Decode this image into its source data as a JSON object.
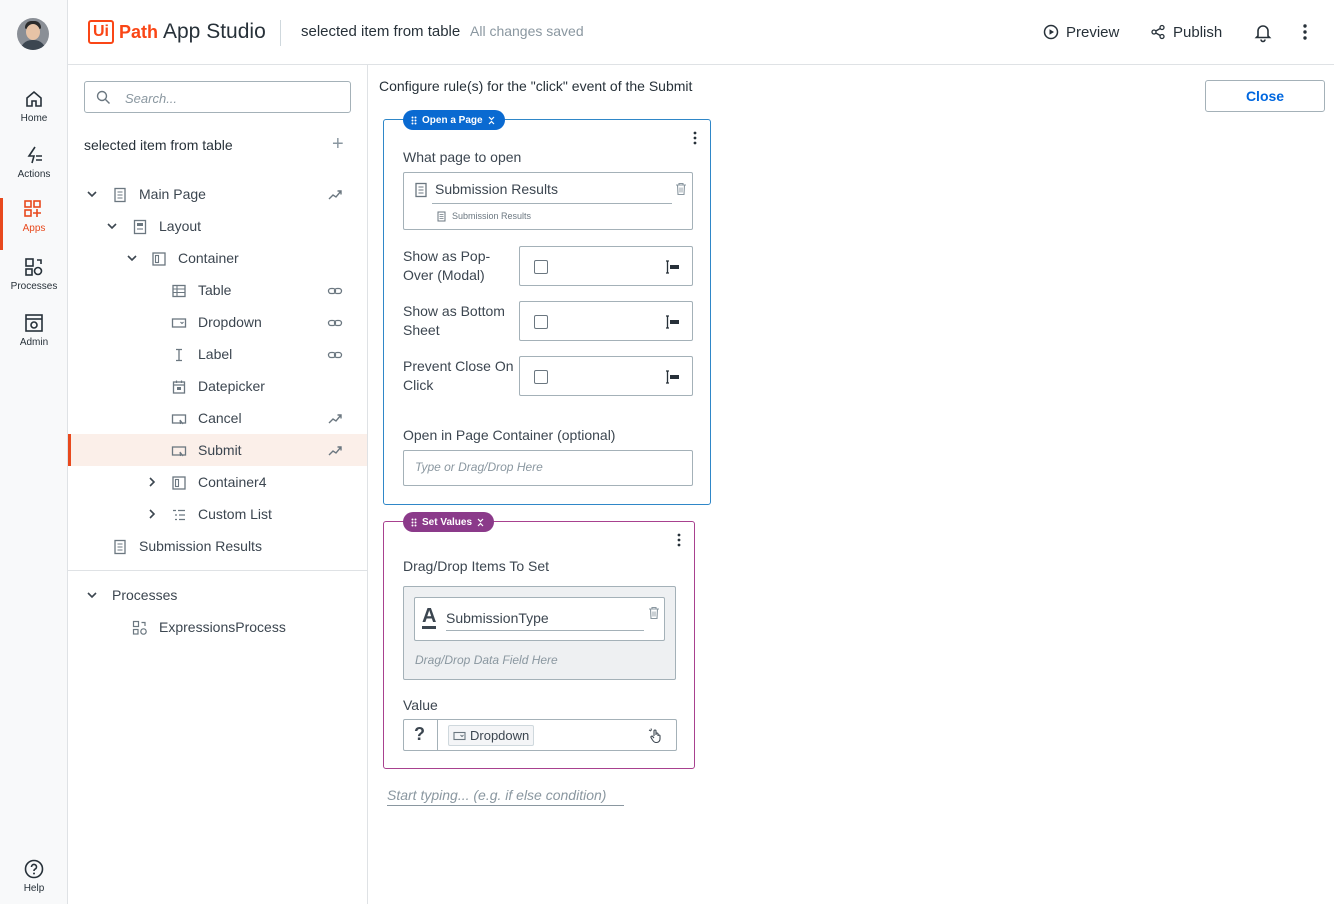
{
  "nav": {
    "items": [
      {
        "label": "Home",
        "icon": "home-icon"
      },
      {
        "label": "Actions",
        "icon": "actions-icon"
      },
      {
        "label": "Apps",
        "icon": "apps-icon"
      },
      {
        "label": "Processes",
        "icon": "processes-icon"
      },
      {
        "label": "Admin",
        "icon": "admin-icon"
      }
    ],
    "help": "Help"
  },
  "header": {
    "logo_ui": "Ui",
    "logo_path": "Path",
    "product": "App Studio",
    "app_name": "selected item from table",
    "save_status": "All changes saved",
    "preview": "Preview",
    "publish": "Publish"
  },
  "tree": {
    "search_placeholder": "Search...",
    "title": "selected item from table",
    "nodes": [
      {
        "label": "Main Page"
      },
      {
        "label": "Layout"
      },
      {
        "label": "Container"
      },
      {
        "label": "Table"
      },
      {
        "label": "Dropdown"
      },
      {
        "label": "Label"
      },
      {
        "label": "Datepicker"
      },
      {
        "label": "Cancel"
      },
      {
        "label": "Submit"
      },
      {
        "label": "Container4"
      },
      {
        "label": "Custom List"
      },
      {
        "label": "Submission Results"
      }
    ],
    "processes_label": "Processes",
    "process_item": "ExpressionsProcess"
  },
  "main": {
    "title": "Configure rule(s) for the \"click\" event of the Submit",
    "close": "Close",
    "open_page": {
      "pill": "Open a Page",
      "what_page_label": "What page to open",
      "page_value": "Submission Results",
      "page_sub": "Submission Results",
      "popover_label": "Show as Pop-Over (Modal)",
      "bottom_sheet_label": "Show as Bottom Sheet",
      "prevent_close_label": "Prevent Close On Click",
      "container_label": "Open in Page Container (optional)",
      "container_placeholder": "Type or Drag/Drop Here"
    },
    "set_values": {
      "pill": "Set Values",
      "items_label": "Drag/Drop Items To Set",
      "item_value": "SubmissionType",
      "drop_hint": "Drag/Drop Data Field Here",
      "value_label": "Value",
      "value_chip": "Dropdown"
    },
    "typing_placeholder": "Start typing... (e.g. if else condition)"
  },
  "colors": {
    "brand": "#fa4616",
    "accent": "#0067df",
    "open_page_pill": "#0a6ad1",
    "set_values_pill": "#8b3a8a"
  }
}
